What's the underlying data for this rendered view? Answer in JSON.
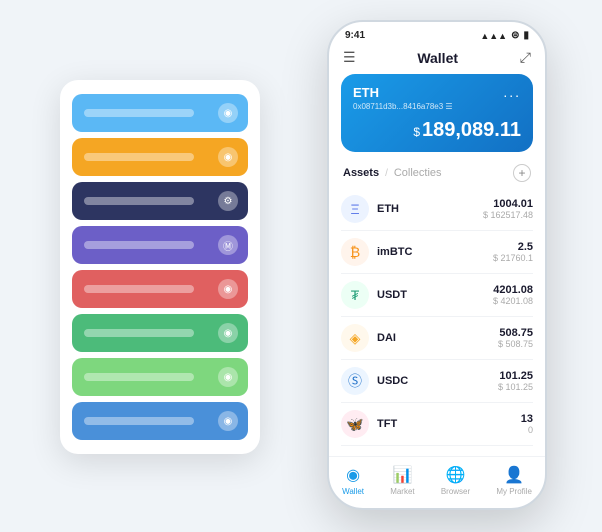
{
  "app": {
    "title": "Wallet"
  },
  "status_bar": {
    "time": "9:41",
    "signal": "▲▲▲",
    "wifi": "WiFi",
    "battery": "■"
  },
  "header": {
    "menu_icon": "☰",
    "title": "Wallet",
    "expand_icon": "⤢"
  },
  "eth_card": {
    "label": "ETH",
    "dots": "...",
    "address": "0x08711d3b...8416a78e3 ☰",
    "balance_symbol": "$",
    "balance": "189,089.11"
  },
  "assets_section": {
    "tab_active": "Assets",
    "tab_divider": "/",
    "tab_inactive": "Collecties",
    "add_label": "+"
  },
  "assets": [
    {
      "name": "ETH",
      "icon": "Ξ",
      "icon_class": "icon-eth",
      "amount": "1004.01",
      "usd": "$ 162517.48"
    },
    {
      "name": "imBTC",
      "icon": "₿",
      "icon_class": "icon-imbtc",
      "amount": "2.5",
      "usd": "$ 21760.1"
    },
    {
      "name": "USDT",
      "icon": "₮",
      "icon_class": "icon-usdt",
      "amount": "4201.08",
      "usd": "$ 4201.08"
    },
    {
      "name": "DAI",
      "icon": "◈",
      "icon_class": "icon-dai",
      "amount": "508.75",
      "usd": "$ 508.75"
    },
    {
      "name": "USDC",
      "icon": "Ⓢ",
      "icon_class": "icon-usdc",
      "amount": "101.25",
      "usd": "$ 101.25"
    },
    {
      "name": "TFT",
      "icon": "🦋",
      "icon_class": "icon-tft",
      "amount": "13",
      "usd": "0"
    }
  ],
  "bottom_nav": [
    {
      "label": "Wallet",
      "icon": "◉",
      "active": true
    },
    {
      "label": "Market",
      "icon": "📊",
      "active": false
    },
    {
      "label": "Browser",
      "icon": "🌐",
      "active": false
    },
    {
      "label": "My Profile",
      "icon": "👤",
      "active": false
    }
  ],
  "card_stack": {
    "cards": [
      {
        "color": "#5bb8f5",
        "text_color": "#4a9fd4"
      },
      {
        "color": "#f5a623",
        "text_color": "#e0952a"
      },
      {
        "color": "#2d3561",
        "text_color": "#3d4571"
      },
      {
        "color": "#6c5fc7",
        "text_color": "#7c6fd7"
      },
      {
        "color": "#e06060",
        "text_color": "#d05050"
      },
      {
        "color": "#4cbb7a",
        "text_color": "#3caa6a"
      },
      {
        "color": "#7ed77e",
        "text_color": "#6ec76e"
      },
      {
        "color": "#4a90d9",
        "text_color": "#3a80c9"
      }
    ]
  }
}
